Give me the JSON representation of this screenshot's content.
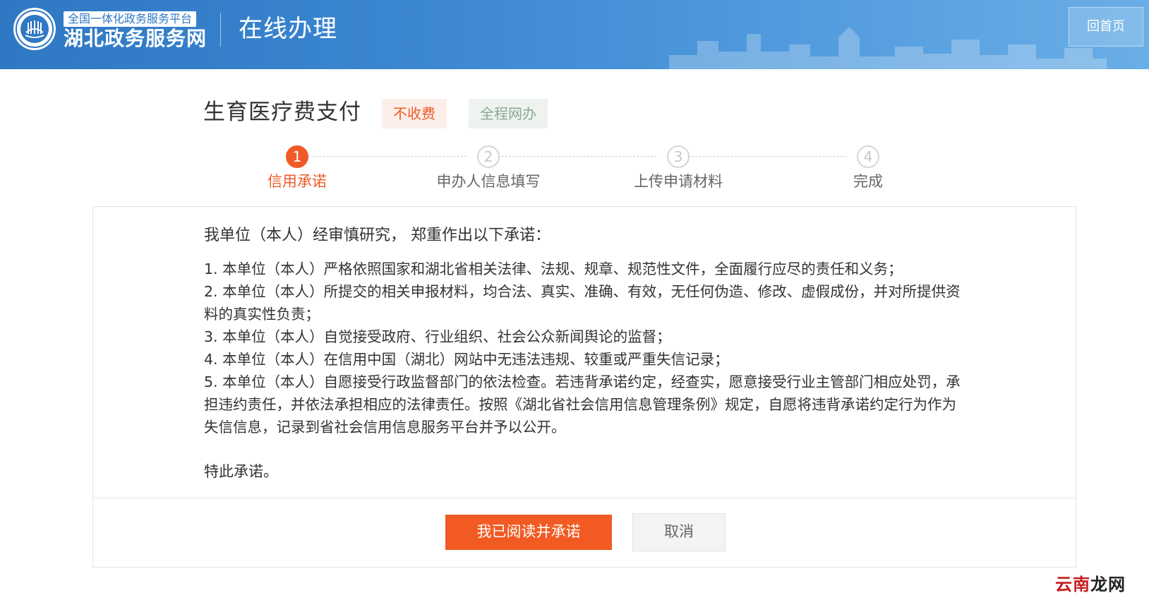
{
  "header": {
    "platform_name": "全国一体化政务服务平台",
    "site_name": "湖北政务服务网",
    "section_title": "在线办理",
    "home_button": "回首页"
  },
  "service": {
    "title": "生育医疗费支付",
    "tag_fee": "不收费",
    "tag_online": "全程网办"
  },
  "steps": [
    {
      "number": "1",
      "label": "信用承诺",
      "state": "active"
    },
    {
      "number": "2",
      "label": "申办人信息填写",
      "state": "todo"
    },
    {
      "number": "3",
      "label": "上传申请材料",
      "state": "todo"
    },
    {
      "number": "4",
      "label": "完成",
      "state": "todo"
    }
  ],
  "commitment": {
    "intro": "我单位（本人）经审慎研究， 郑重作出以下承诺：",
    "items": [
      "1. 本单位（本人）严格依照国家和湖北省相关法律、法规、规章、规范性文件，全面履行应尽的责任和义务；",
      "2. 本单位（本人）所提交的相关申报材料，均合法、真实、准确、有效，无任何伪造、修改、虚假成份，并对所提供资料的真实性负责；",
      "3. 本单位（本人）自觉接受政府、行业组织、社会公众新闻舆论的监督；",
      "4. 本单位（本人）在信用中国（湖北）网站中无违法违规、较重或严重失信记录；",
      "5. 本单位（本人）自愿接受行政监督部门的依法检查。若违背承诺约定，经查实，愿意接受行业主管部门相应处罚，承担违约责任，并依法承担相应的法律责任。按照《湖北省社会信用信息管理条例》规定，自愿将违背承诺约定行为作为失信信息，记录到省社会信用信息服务平台并予以公开。"
    ],
    "closing": "特此承诺。"
  },
  "actions": {
    "confirm": "我已阅读并承诺",
    "cancel": "取消"
  },
  "watermark": {
    "part1": "云南",
    "part2": "龙网"
  },
  "colors": {
    "header_blue": "#3b86d0",
    "accent_orange": "#f15a22",
    "tag_fee_text": "#f0592b",
    "tag_online_text": "#8aa893"
  }
}
